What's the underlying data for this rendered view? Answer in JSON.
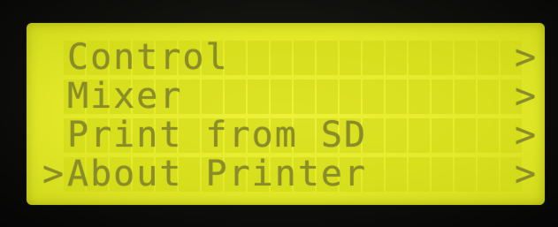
{
  "display": {
    "background_color": "#e6ec2c",
    "text_color": "#8a8c2a"
  },
  "menu": {
    "items": [
      {
        "label": "Control",
        "arrow": ">",
        "cursor": ""
      },
      {
        "label": "Mixer",
        "arrow": ">",
        "cursor": ""
      },
      {
        "label": "Print from SD",
        "arrow": ">",
        "cursor": ""
      },
      {
        "label": "About Printer",
        "arrow": ">",
        "cursor": ">"
      }
    ],
    "selected_index": 3
  }
}
